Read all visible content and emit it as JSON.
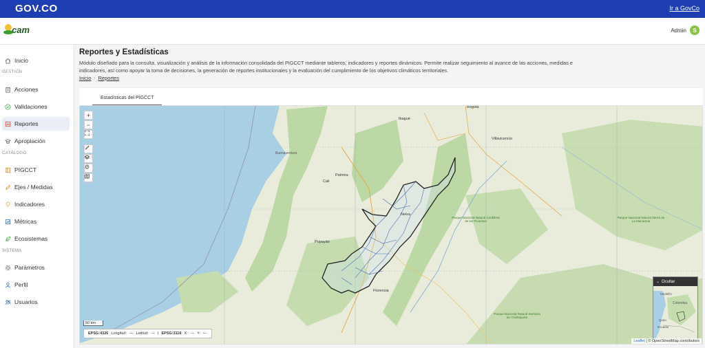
{
  "topbar": {
    "brand": "GOV.CO",
    "link": "Ir a GovCo"
  },
  "header": {
    "logo_text": "cam",
    "user_name": "Admin",
    "user_initial": "S"
  },
  "sidebar": {
    "inicio": "Inicio",
    "section_gestion": "GESTIÓN",
    "acciones": "Acciones",
    "validaciones": "Validaciones",
    "reportes": "Reportes",
    "apropiacion": "Apropiación",
    "section_catalogo": "CATÁLOGO",
    "pigcct": "PIGCCT",
    "ejes": "Ejes / Medidas",
    "indicadores": "Indicadores",
    "metricas": "Métricas",
    "ecosistemas": "Ecosistemas",
    "section_sistema": "SISTEMA",
    "parametros": "Parámetros",
    "perfil": "Perfil",
    "usuarios": "Usuarios"
  },
  "page": {
    "title": "Reportes y Estadísticas",
    "description": "Módulo diseñado para la consulta, visualización y análisis de la información consolidada del PIGCCT mediante tableros, indicadores y reportes dinámicos. Permite realizar seguimiento al avance de las acciones, medidas e indicadores, así como apoyar la toma de decisiones, la generación de reportes institucionales y la evaluación del cumplimiento de los objetivos climáticos territoriales.",
    "breadcrumb": [
      "Inicio",
      "Reportes"
    ],
    "tab": "Estadísticas del PIGCCT"
  },
  "map": {
    "zoom_in": "+",
    "zoom_out": "−",
    "scale": "50 km",
    "coords": {
      "epsg4326": "EPSG:4326",
      "lon_label": "Longitud:",
      "lon_value": "—",
      "lat_label": "Latitud:",
      "lat_value": "—",
      "sep": "|",
      "epsg3116": "EPSG:3116",
      "x_label": "X:",
      "x_value": "—",
      "y_label": "Y:",
      "y_value": "—"
    },
    "minimap_toggle": "Ocultar",
    "attribution_leaflet": "Leaflet",
    "attribution_osm": "| © OpenStreetMap contributors",
    "labels": {
      "bogota": "Bogotá",
      "ibague": "Ibagué",
      "villavicencio": "Villavicencio",
      "neiva": "Neiva",
      "florencia": "Florencia",
      "cali": "Cali",
      "popayan": "Popayán",
      "palmira": "Palmira",
      "buenaventura": "Buenaventura",
      "park_picachos": "Parque Nacional Natural Cordillera de los Picachos",
      "park_macarena": "Parque Nacional Natural Sierra de La Macarena",
      "park_chiribiquete": "Parque Nacional Natural Serranía de Chiribiquete",
      "minimap_colombia": "Colombia",
      "minimap_medellin": "Medellín",
      "minimap_quito": "Quito",
      "minimap_ecuador": "Ecuador"
    }
  }
}
